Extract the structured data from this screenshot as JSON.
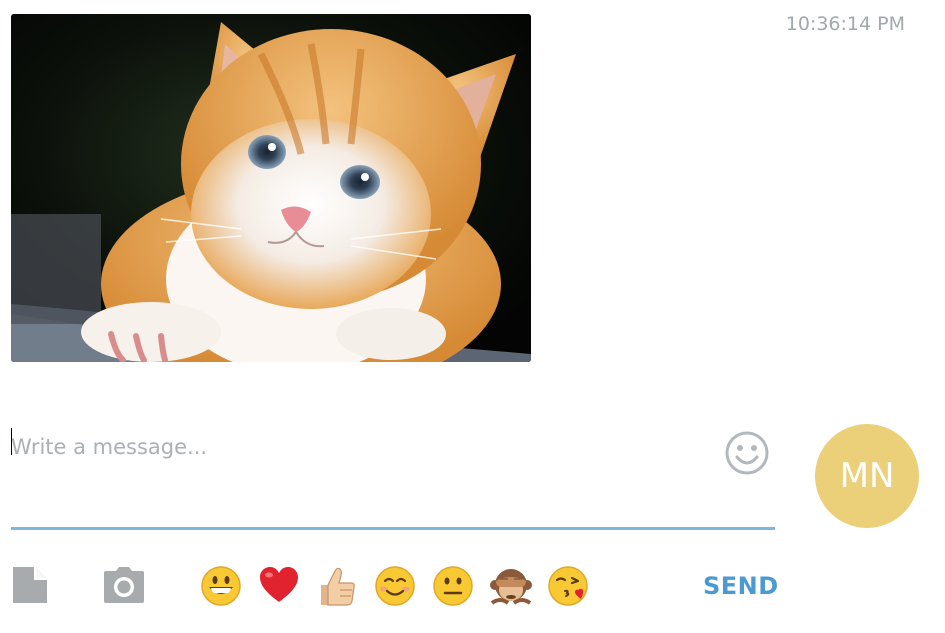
{
  "message": {
    "timestamp": "10:36:14 PM",
    "image_subject": "kitten-photo"
  },
  "composer": {
    "placeholder": "Write a message...",
    "value": ""
  },
  "avatar": {
    "initials": "MN",
    "color": "#ebd079"
  },
  "toolbar": {
    "icons": [
      "file-icon",
      "camera-icon"
    ],
    "emojis": [
      "grinning-face",
      "red-heart",
      "thumbs-up",
      "smiling-face",
      "neutral-face",
      "see-no-evil-monkey",
      "kissing-heart-face"
    ],
    "send_label": "SEND"
  },
  "colors": {
    "accent": "#4d9ad3",
    "underline": "#80b5dc",
    "muted": "#a2a8ad"
  }
}
